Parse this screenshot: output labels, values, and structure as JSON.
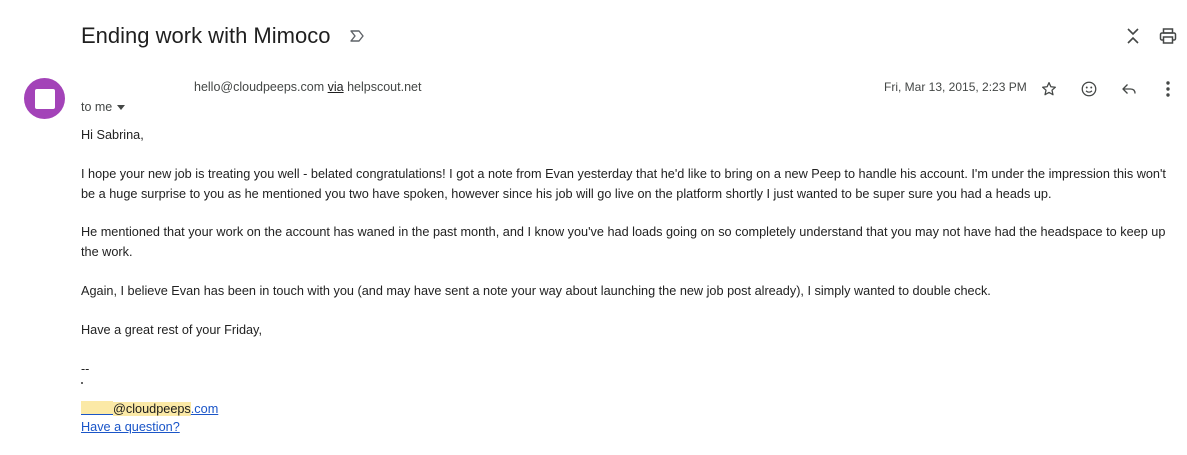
{
  "email": {
    "subject": "Ending work with Mimoco",
    "label_icon": "label-importance-icon",
    "sender_address": "hello@cloudpeeps.com",
    "sender_via_word": "via",
    "sender_via_domain": "helpscout.net",
    "to_label": "to me",
    "date": "Fri, Mar 13, 2015, 2:23 PM",
    "avatar_color": "#a343b8"
  },
  "header_actions": {
    "collapse_icon": "collapse-all-icon",
    "print_icon": "print-icon"
  },
  "message_actions": {
    "star_icon": "star-icon",
    "emoji_icon": "emoji-icon",
    "reply_icon": "reply-icon",
    "more_icon": "more-vert-icon"
  },
  "body": {
    "greeting": "Hi Sabrina,",
    "paragraphs": [
      "I hope your new job is treating you well - belated congratulations! I got a note from Evan yesterday that he'd like to bring on a new Peep to handle his account. I'm under the impression this won't be a huge surprise to you as he mentioned you two have spoken, however since his job will go live on the platform shortly I just wanted to be super sure you had a heads up.",
      "He mentioned that your work on the account has waned in the past month, and I know you've had loads going on so completely understand that you may not have had the headspace to keep up the work.",
      "Again, I believe Evan has been in touch with you (and may have sent a note your way about launching the new job post already), I simply wanted to double check.",
      "Have a great rest of your Friday,"
    ],
    "sig_separator": "--",
    "sig_email_user": "@cloudpeeps",
    "sig_email_tld": ".com",
    "sig_question_link": "Have a question?"
  }
}
